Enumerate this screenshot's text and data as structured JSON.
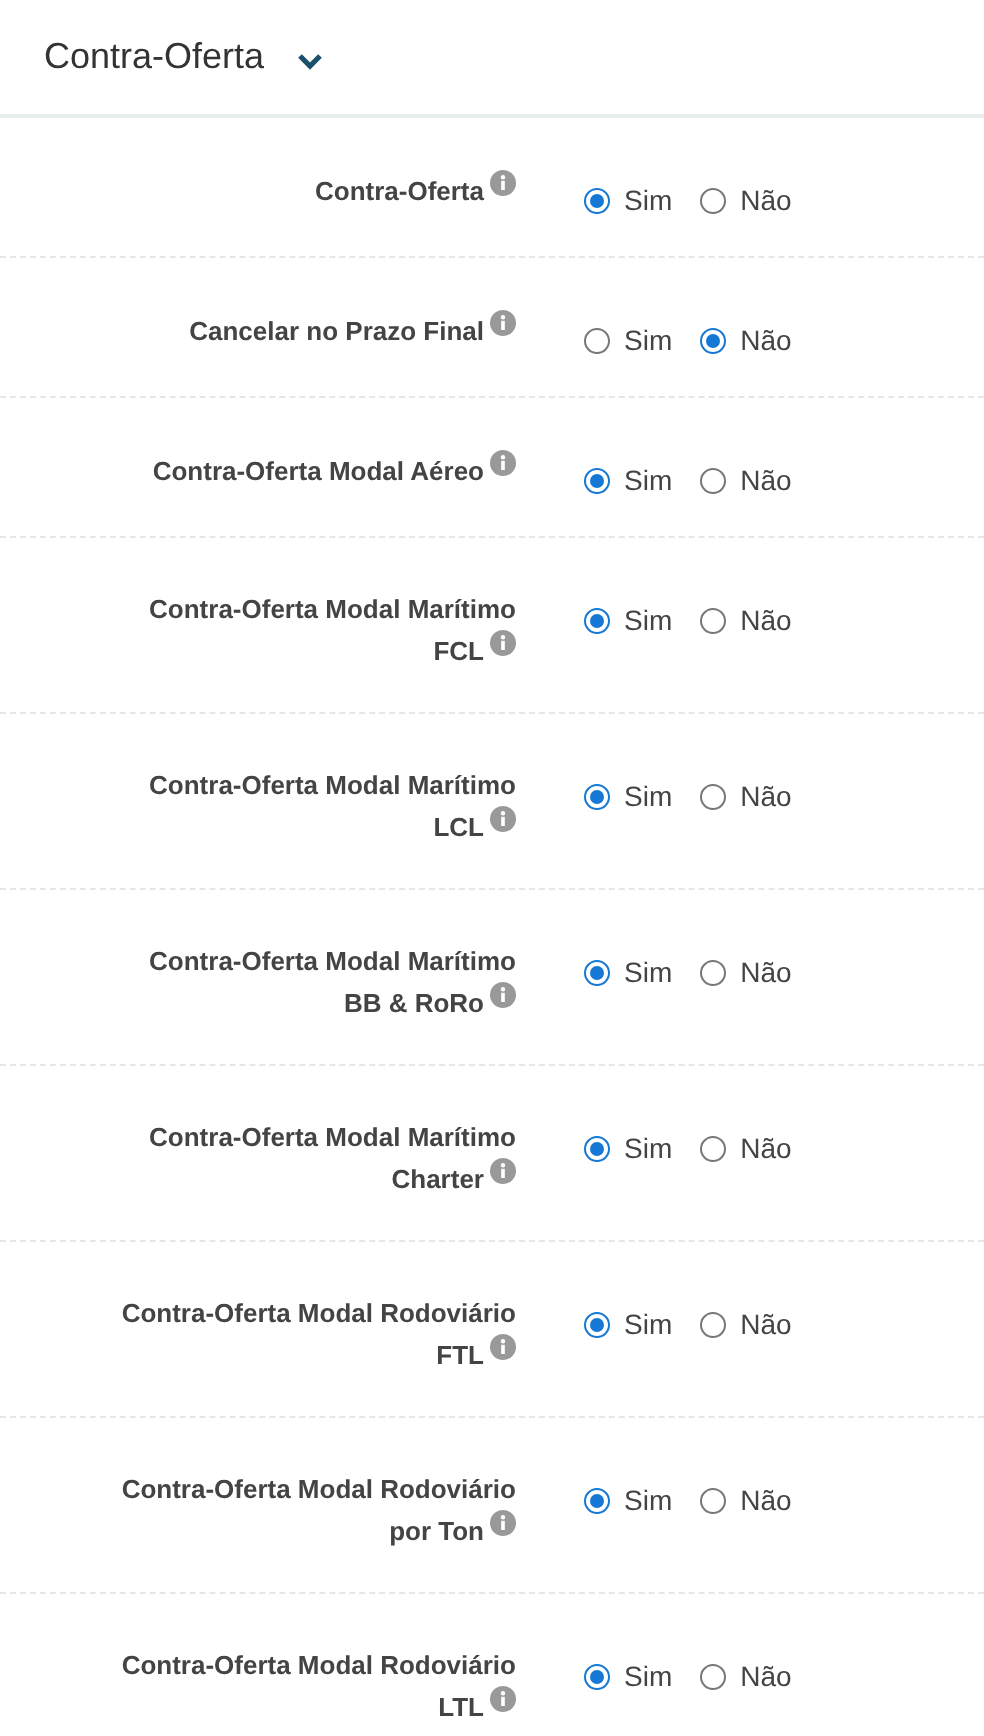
{
  "section": {
    "title": "Contra-Oferta",
    "expanded": true
  },
  "settings": [
    {
      "label": "Contra-Oferta",
      "options": [
        {
          "label": "Sim",
          "selected": true
        },
        {
          "label": "Não",
          "selected": false
        }
      ]
    },
    {
      "label": "Cancelar no Prazo Final",
      "options": [
        {
          "label": "Sim",
          "selected": false
        },
        {
          "label": "Não",
          "selected": true
        }
      ]
    },
    {
      "label": "Contra-Oferta Modal Aéreo",
      "options": [
        {
          "label": "Sim",
          "selected": true
        },
        {
          "label": "Não",
          "selected": false
        }
      ]
    },
    {
      "label": "Contra-Oferta Modal Marítimo FCL",
      "options": [
        {
          "label": "Sim",
          "selected": true
        },
        {
          "label": "Não",
          "selected": false
        }
      ]
    },
    {
      "label": "Contra-Oferta Modal Marítimo LCL",
      "options": [
        {
          "label": "Sim",
          "selected": true
        },
        {
          "label": "Não",
          "selected": false
        }
      ]
    },
    {
      "label": "Contra-Oferta Modal Marítimo BB & RoRo",
      "options": [
        {
          "label": "Sim",
          "selected": true
        },
        {
          "label": "Não",
          "selected": false
        }
      ]
    },
    {
      "label": "Contra-Oferta Modal Marítimo Charter",
      "options": [
        {
          "label": "Sim",
          "selected": true
        },
        {
          "label": "Não",
          "selected": false
        }
      ]
    },
    {
      "label": "Contra-Oferta Modal Rodoviário FTL",
      "options": [
        {
          "label": "Sim",
          "selected": true
        },
        {
          "label": "Não",
          "selected": false
        }
      ]
    },
    {
      "label": "Contra-Oferta Modal Rodoviário por Ton",
      "options": [
        {
          "label": "Sim",
          "selected": true
        },
        {
          "label": "Não",
          "selected": false
        }
      ]
    },
    {
      "label": "Contra-Oferta Modal Rodoviário LTL",
      "options": [
        {
          "label": "Sim",
          "selected": true
        },
        {
          "label": "Não",
          "selected": false
        }
      ]
    }
  ]
}
